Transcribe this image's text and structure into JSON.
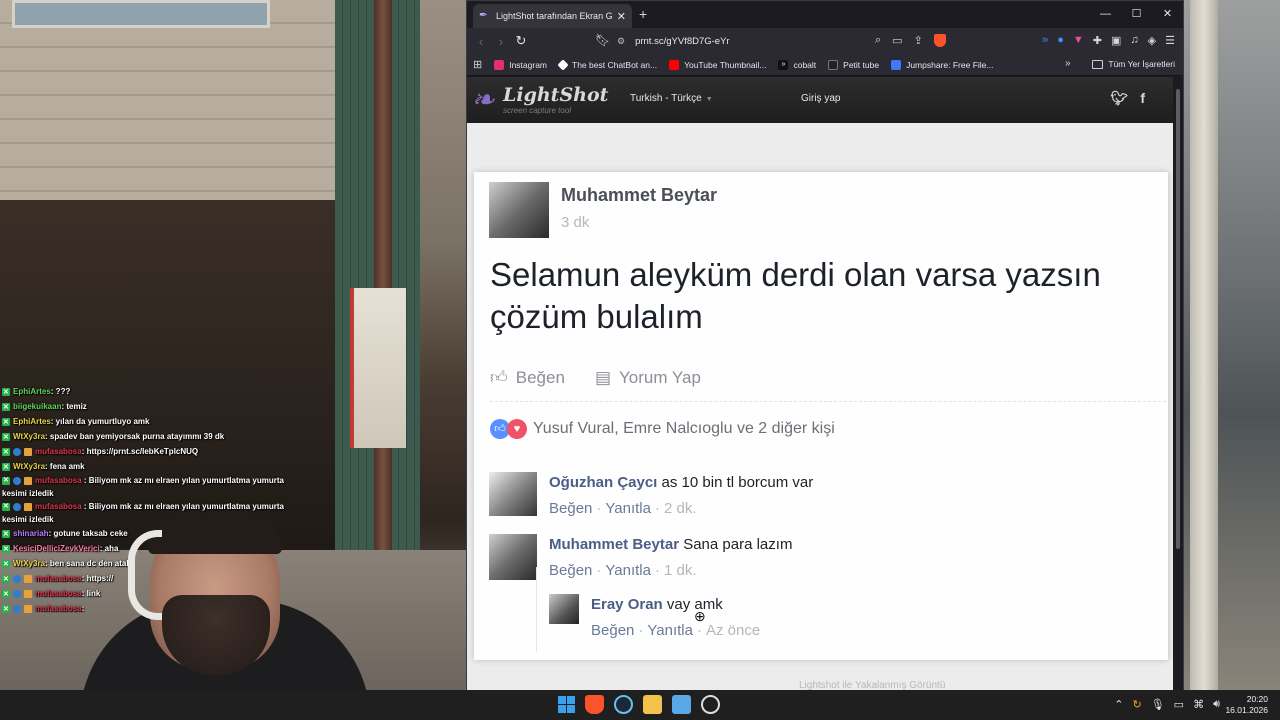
{
  "chat": [
    {
      "user": "EphiArtes",
      "color": "green",
      "text": " : ???"
    },
    {
      "user": "biigekuikaan",
      "color": "green",
      "text": " : temiz"
    },
    {
      "user": "EphiArtes",
      "color": "yellow",
      "text": " : yılan da yumurtluyo amk"
    },
    {
      "user": "WtXy3ra",
      "color": "yellow",
      "text": " : spadev ban yemiyorsak purna atayımmı 39 dk"
    },
    {
      "user": "mufasabosa",
      "color": "red",
      "text": " : https://prnt.sc/lebKeTplcNUQ"
    },
    {
      "user": "WtXy3ra",
      "color": "yellow",
      "text": " : fena amk"
    },
    {
      "user": "mufasabosa",
      "color": "red",
      "text": " : Biliyom mk az mı elraen yılan yumurtlatma yumurta kesimi izledik"
    },
    {
      "user": "mufasabosa",
      "color": "red",
      "text": " : Biliyom mk az mı elraen yılan yumurtlatma yumurta kesimi izledik"
    },
    {
      "user": "shinariah",
      "color": "purple",
      "text": " : gotune taksab ceke"
    },
    {
      "user": "KesiciDelliciZevkVerici",
      "color": "pink",
      "text": " : aha"
    },
    {
      "user": "WtXy3ra",
      "color": "yellow",
      "text": " : ben sana dc den atal"
    },
    {
      "user": "mufasabosa",
      "color": "red",
      "text": " : https://"
    },
    {
      "user": "mufasabosa",
      "color": "red",
      "text": " : link"
    },
    {
      "user": "mufasabosa",
      "color": "red",
      "text": " : "
    }
  ],
  "browser": {
    "tab_title": "LightShot tarafından Ekran Görü",
    "url": "prnt.sc/gYVf8D7G-eYr",
    "bookmarks": [
      {
        "label": "Instagram",
        "color": "#e1306c"
      },
      {
        "label": "The best ChatBot an...",
        "color": "#ffffff"
      },
      {
        "label": "YouTube Thumbnail...",
        "color": "#ff0000"
      },
      {
        "label": "cobalt",
        "color": "#111111"
      },
      {
        "label": "Petit tube",
        "color": "#222222"
      },
      {
        "label": "Jumpshare: Free File...",
        "color": "#3b7cf6"
      }
    ],
    "all_bookmarks": "Tüm Yer İşaretleri"
  },
  "lightshot": {
    "logo": "LightShot",
    "tagline": "screen capture tool",
    "language": "Turkish - Türkçe",
    "login": "Giriş yap",
    "footer": "Lightshot ile Yakalanmış Görüntü"
  },
  "post": {
    "author": "Muhammet Beytar",
    "time": "3 dk",
    "text": "Selamun aleyküm derdi olan varsa yazsın çözüm bulalım",
    "like_label": "Beğen",
    "comment_label": "Yorum Yap",
    "reactions": "Yusuf Vural, Emre Nalcıoglu ve 2 diğer kişi"
  },
  "comments": [
    {
      "name": "Oğuzhan Çaycı",
      "text": " as 10 bin tl borcum var",
      "like": "Beğen",
      "reply": "Yanıtla",
      "age": "2 dk."
    },
    {
      "name": "Muhammet Beytar",
      "text": " Sana para lazım",
      "like": "Beğen",
      "reply": "Yanıtla",
      "age": "1 dk."
    },
    {
      "name": "Eray Oran",
      "text": " vay amk",
      "like": "Beğen",
      "reply": "Yanıtla",
      "age": "Az önce"
    }
  ],
  "taskbar": {
    "time": "20:20",
    "date": "16.01.2026"
  }
}
